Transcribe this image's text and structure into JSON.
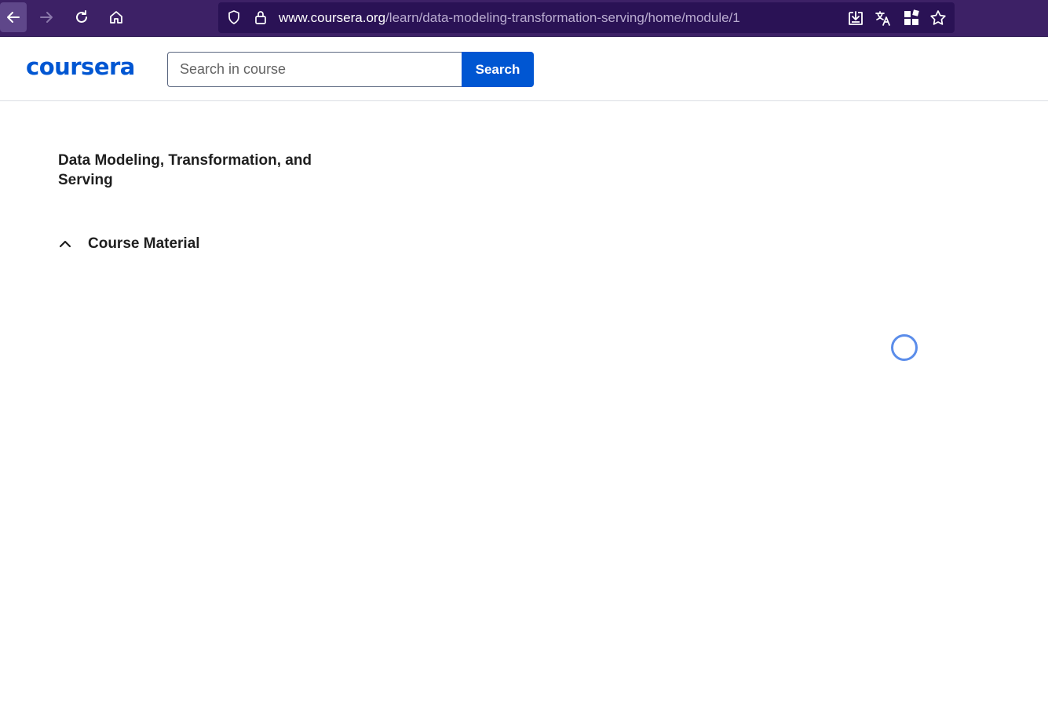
{
  "browser": {
    "url_domain": "www.coursera.org",
    "url_path": "/learn/data-modeling-transformation-serving/home/module/1",
    "nav_icons": [
      "back-arrow-icon",
      "forward-arrow-icon",
      "reload-icon",
      "home-icon"
    ],
    "url_icons": [
      "shield-icon",
      "lock-icon"
    ],
    "action_icons": [
      "download-icon",
      "translate-icon",
      "extensions-icon",
      "bookmark-star-icon"
    ],
    "colors": {
      "chrome": "#3d2166",
      "url_bar": "#2a1255"
    }
  },
  "header": {
    "logo_text": "coursera",
    "search_placeholder": "Search in course",
    "search_button": "Search",
    "colors": {
      "brand": "#0056d2"
    }
  },
  "sidebar": {
    "course_title": "Data Modeling, Transformation, and Serving",
    "section_label": "Course Material",
    "section_icon": "chevron-up-icon",
    "section_expanded": true
  },
  "main": {
    "loading": true,
    "spinner_icon": "loading-spinner-icon"
  }
}
